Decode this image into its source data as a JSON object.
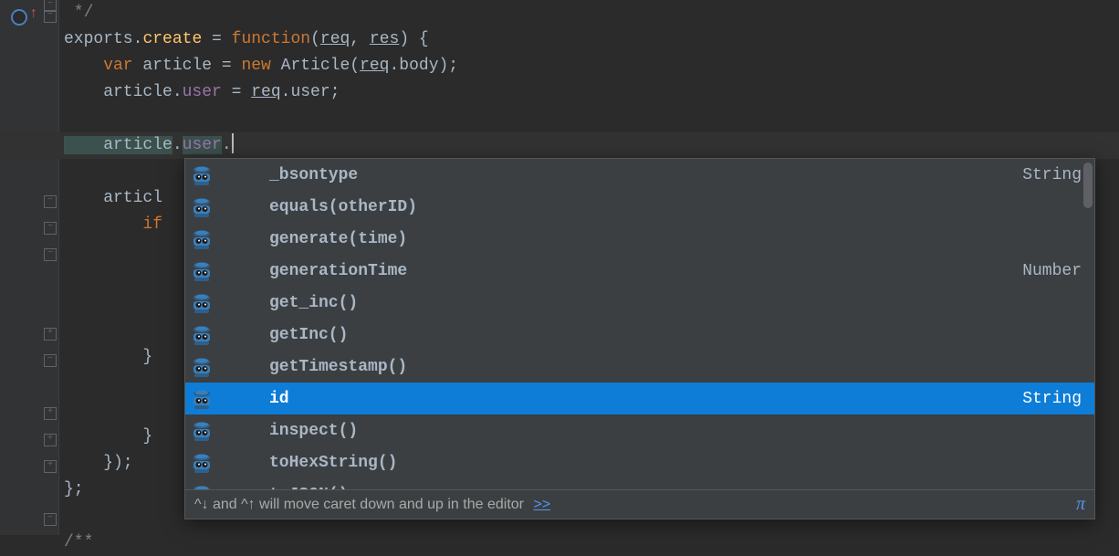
{
  "code": {
    "comment_end": " */",
    "l1_exports": "exports",
    "l1_dot1": ".",
    "l1_create": "create",
    "l1_eq": " = ",
    "l1_function": "function",
    "l1_p1": "(",
    "l1_req": "req",
    "l1_comma": ", ",
    "l1_res": "res",
    "l1_p2": ") {",
    "l2_var": "    var",
    "l2_article": " article = ",
    "l2_new": "new",
    "l2_Article": " Article(",
    "l2_req": "req",
    "l2_body": ".body);",
    "l3_article": "    article.",
    "l3_user": "user",
    "l3_eq": " = ",
    "l3_req": "req",
    "l3_user2": ".user;",
    "l5_article": "    article",
    "l5_dot": ".",
    "l5_user": "user",
    "l5_dot2": ".",
    "l7_article": "    articl",
    "l8_if": "        if",
    "l13_brace": "        }",
    "l16_brace": "        }",
    "l17_close": "    });",
    "l18_close": "};",
    "l20_doc": "/**"
  },
  "autocomplete": {
    "items": [
      {
        "label": "_bsontype",
        "type": "String",
        "selected": false
      },
      {
        "label": "equals(otherID)",
        "type": "",
        "selected": false
      },
      {
        "label": "generate(time)",
        "type": "",
        "selected": false
      },
      {
        "label": "generationTime",
        "type": "Number",
        "selected": false
      },
      {
        "label": "get_inc()",
        "type": "",
        "selected": false
      },
      {
        "label": "getInc()",
        "type": "",
        "selected": false
      },
      {
        "label": "getTimestamp()",
        "type": "",
        "selected": false
      },
      {
        "label": "id",
        "type": "String",
        "selected": true
      },
      {
        "label": "inspect()",
        "type": "",
        "selected": false
      },
      {
        "label": "toHexString()",
        "type": "",
        "selected": false
      },
      {
        "label": "toJSON()",
        "type": "",
        "selected": false
      }
    ],
    "hint": "^↓ and ^↑ will move caret down and up in the editor  ",
    "hint_link": ">>"
  }
}
